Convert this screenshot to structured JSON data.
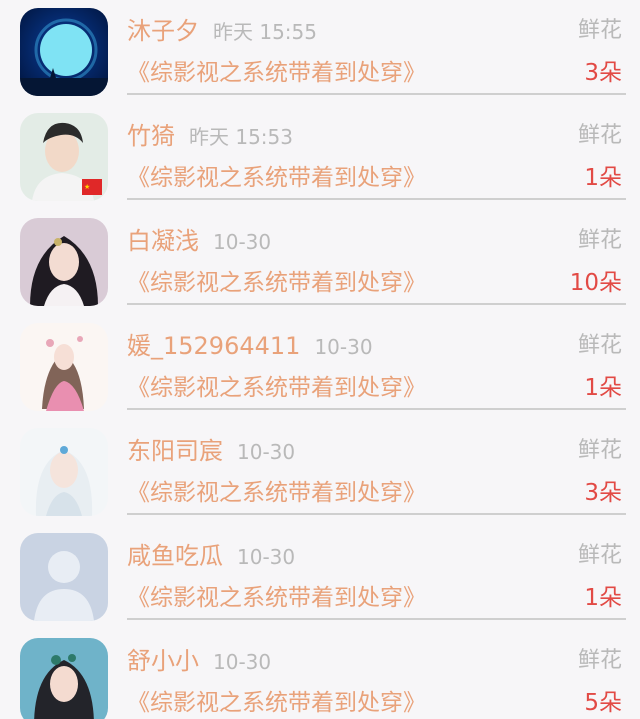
{
  "items": [
    {
      "name": "沐子夕",
      "time": "昨天 15:55",
      "gift": "鲜花",
      "title": "《综影视之系统带着到处穿》",
      "count": "3朵",
      "avatar_icon": "moon-silhouette-avatar"
    },
    {
      "name": "竹猗",
      "time": "昨天 15:53",
      "gift": "鲜花",
      "title": "《综影视之系统带着到处穿》",
      "count": "1朵",
      "avatar_icon": "young-man-flag-avatar"
    },
    {
      "name": "白凝浅",
      "time": "10-30",
      "gift": "鲜花",
      "title": "《综影视之系统带着到处穿》",
      "count": "10朵",
      "avatar_icon": "costume-woman-avatar"
    },
    {
      "name": "媛_152964411",
      "time": "10-30",
      "gift": "鲜花",
      "title": "《综影视之系统带着到处穿》",
      "count": "1朵",
      "avatar_icon": "illustrated-woman-avatar"
    },
    {
      "name": "东阳司宸",
      "time": "10-30",
      "gift": "鲜花",
      "title": "《综影视之系统带着到处穿》",
      "count": "3朵",
      "avatar_icon": "white-hair-man-avatar"
    },
    {
      "name": "咸鱼吃瓜",
      "time": "10-30",
      "gift": "鲜花",
      "title": "《综影视之系统带着到处穿》",
      "count": "1朵",
      "avatar_icon": "default-user-avatar"
    },
    {
      "name": "舒小小",
      "time": "10-30",
      "gift": "鲜花",
      "title": "《综影视之系统带着到处穿》",
      "count": "5朵",
      "avatar_icon": "costume-woman-avatar"
    }
  ],
  "colors": {
    "name": "#e9a27a",
    "meta": "#b9b9b9",
    "count": "#e24a45",
    "background": "#f7f6f8"
  }
}
